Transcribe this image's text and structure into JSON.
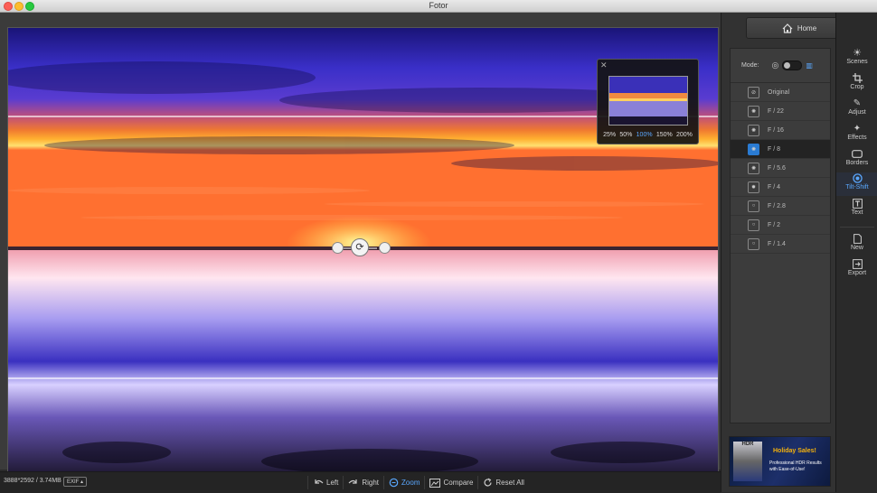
{
  "window": {
    "title": "Fotor"
  },
  "navigator": {
    "close_label": "✕",
    "zoom_levels": [
      "25%",
      "50%",
      "100%",
      "150%",
      "200%"
    ],
    "active_zoom": "100%"
  },
  "status": {
    "file_info": "3888*2592 / 3.74MB",
    "exif_label": "EXIF ▴"
  },
  "bottom_tools": [
    {
      "label": "Left",
      "icon": "rotate-left-icon"
    },
    {
      "label": "Right",
      "icon": "rotate-right-icon"
    },
    {
      "label": "Zoom",
      "icon": "zoom-icon"
    },
    {
      "label": "Compare",
      "icon": "compare-icon"
    },
    {
      "label": "Reset All",
      "icon": "reset-icon"
    }
  ],
  "panel": {
    "home_label": "Home",
    "mode_label": "Mode:",
    "apertures": [
      "Original",
      "F / 22",
      "F / 16",
      "F / 8",
      "F / 5.6",
      "F / 4",
      "F / 2.8",
      "F / 2",
      "F / 1.4"
    ],
    "selected_aperture": "F / 8",
    "ad": {
      "box_text": "HDR",
      "title": "Holiday Sales!",
      "subtitle": "Professional HDR Results with Ease-of-Use!"
    }
  },
  "sidebar": {
    "items": [
      {
        "label": "Scenes",
        "icon": "sun-icon"
      },
      {
        "label": "Crop",
        "icon": "crop-icon"
      },
      {
        "label": "Adjust",
        "icon": "pencil-icon"
      },
      {
        "label": "Effects",
        "icon": "sparkle-icon"
      },
      {
        "label": "Borders",
        "icon": "border-icon"
      },
      {
        "label": "Tilt-Shift",
        "icon": "tilt-shift-icon"
      },
      {
        "label": "Text",
        "icon": "text-icon"
      },
      {
        "label": "New",
        "icon": "new-file-icon"
      },
      {
        "label": "Export",
        "icon": "export-icon"
      }
    ],
    "active": "Tilt-Shift"
  },
  "colors": {
    "accent": "#5aa8ff",
    "selected_fill": "#2a7bd3"
  }
}
